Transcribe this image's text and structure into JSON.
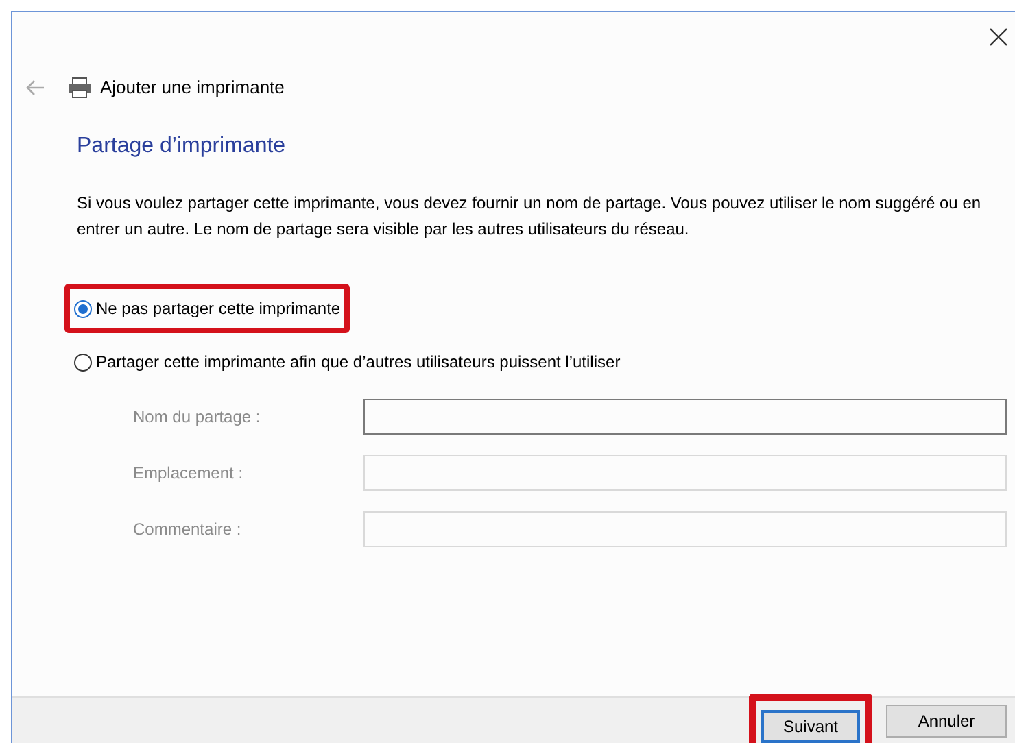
{
  "window": {
    "title": "Ajouter une imprimante"
  },
  "heading": "Partage d’imprimante",
  "description": "Si vous voulez partager cette imprimante, vous devez fournir un nom de partage. Vous pouvez utiliser le nom suggéré ou en entrer un autre. Le nom de partage sera visible par les autres utilisateurs du réseau.",
  "options": [
    {
      "label": "Ne pas partager cette imprimante",
      "selected": true,
      "highlighted": true
    },
    {
      "label": "Partager cette imprimante afin que d’autres utilisateurs puissent l’utiliser",
      "selected": false,
      "highlighted": false
    }
  ],
  "fields": [
    {
      "label": "Nom du partage :",
      "disabled": true,
      "focused": true
    },
    {
      "label": "Emplacement :",
      "disabled": true,
      "focused": false
    },
    {
      "label": "Commentaire :",
      "disabled": true,
      "focused": false
    }
  ],
  "buttons": [
    {
      "label": "Suivant",
      "default": true,
      "highlighted": true
    },
    {
      "label": "Annuler",
      "default": false,
      "highlighted": false
    }
  ]
}
